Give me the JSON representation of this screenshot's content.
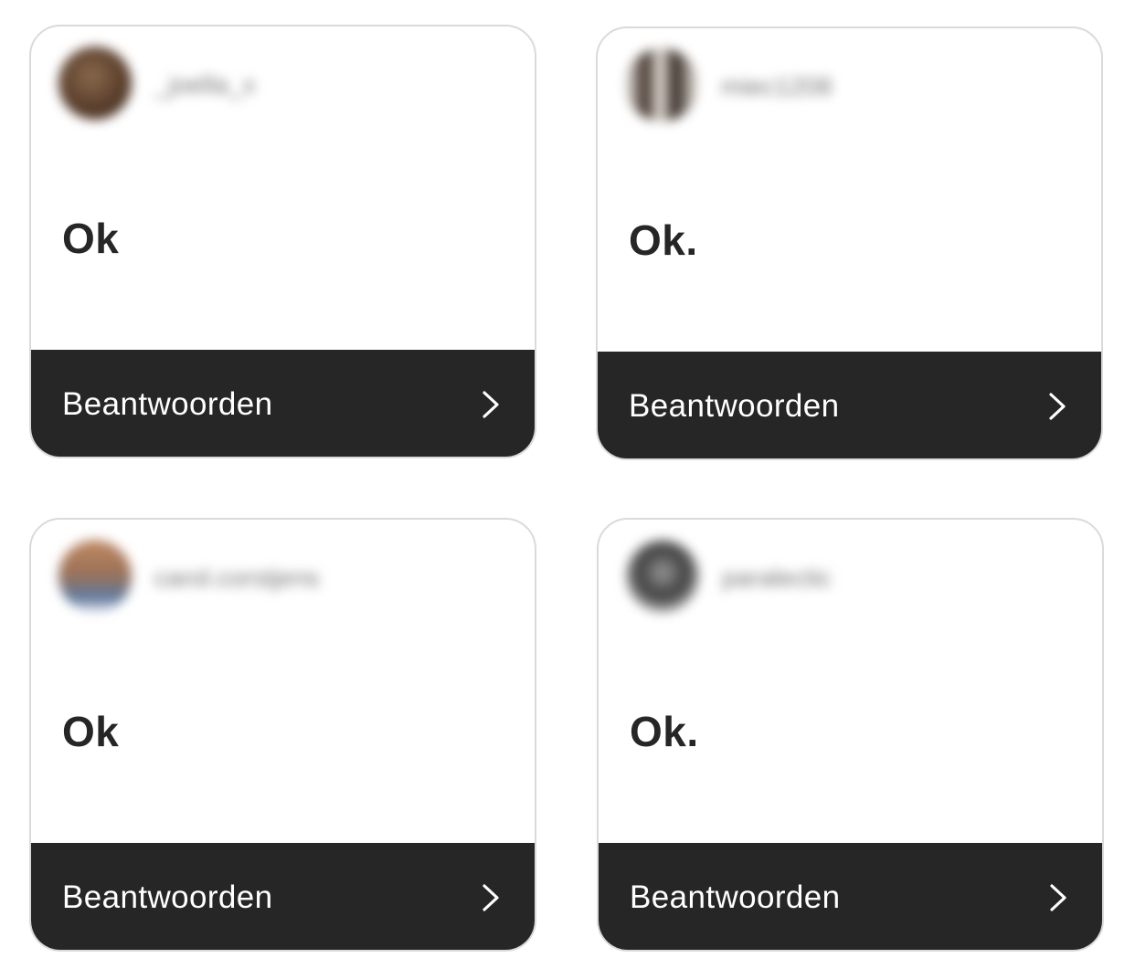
{
  "cards": [
    {
      "username": "_joella_x",
      "message": "Ok",
      "reply_label": "Beantwoorden",
      "avatar_color": "#5a3e2b"
    },
    {
      "username": "miec1208",
      "message": "Ok.",
      "reply_label": "Beantwoorden",
      "avatar_color": "#6b5a4d"
    },
    {
      "username": "carol.corstjens",
      "message": "Ok",
      "reply_label": "Beantwoorden",
      "avatar_color": "#8c7a70"
    },
    {
      "username": "paralectic",
      "message": "Ok.",
      "reply_label": "Beantwoorden",
      "avatar_color": "#555555"
    }
  ],
  "icons": {
    "reply_chevron": "chevron-right-icon"
  },
  "colors": {
    "reply_bar": "#262626",
    "card_border": "#dadada",
    "message_text": "#262626"
  }
}
